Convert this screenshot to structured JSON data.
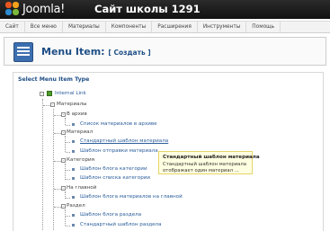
{
  "header": {
    "logo_text": "Joomla!",
    "site_title": "Сайт школы 1291"
  },
  "menu": {
    "items": [
      "Сайт",
      "Все меню",
      "Материалы",
      "Компоненты",
      "Расширения",
      "Инструменты",
      "Помощь"
    ]
  },
  "toolbar": {
    "title": "Menu Item:",
    "subtitle": "[ Создать ]"
  },
  "panel": {
    "legend": "Select Menu Item Type"
  },
  "tree": {
    "internal_link": "Internal Link",
    "materials": "Материалы",
    "archive": "В архив",
    "archive_list": "Список материалов в архиве",
    "article": "Материал",
    "article_default": "Стандартный шаблон материала",
    "article_submit": "Шаблон отправки материала",
    "category": "Категория",
    "category_blog": "Шаблон блога категории",
    "category_list": "Шаблон списка категории",
    "frontpage": "На главной",
    "frontpage_blog": "Шаблон блога материалов на главной",
    "section": "Раздел",
    "section_blog": "Шаблон блога раздела",
    "section_default": "Стандартный шаблон раздела"
  },
  "tooltip": {
    "title": "Стандартный шаблон материала",
    "line1": "Стандартный шаблон материала",
    "line2": "отображает один материал ..."
  }
}
